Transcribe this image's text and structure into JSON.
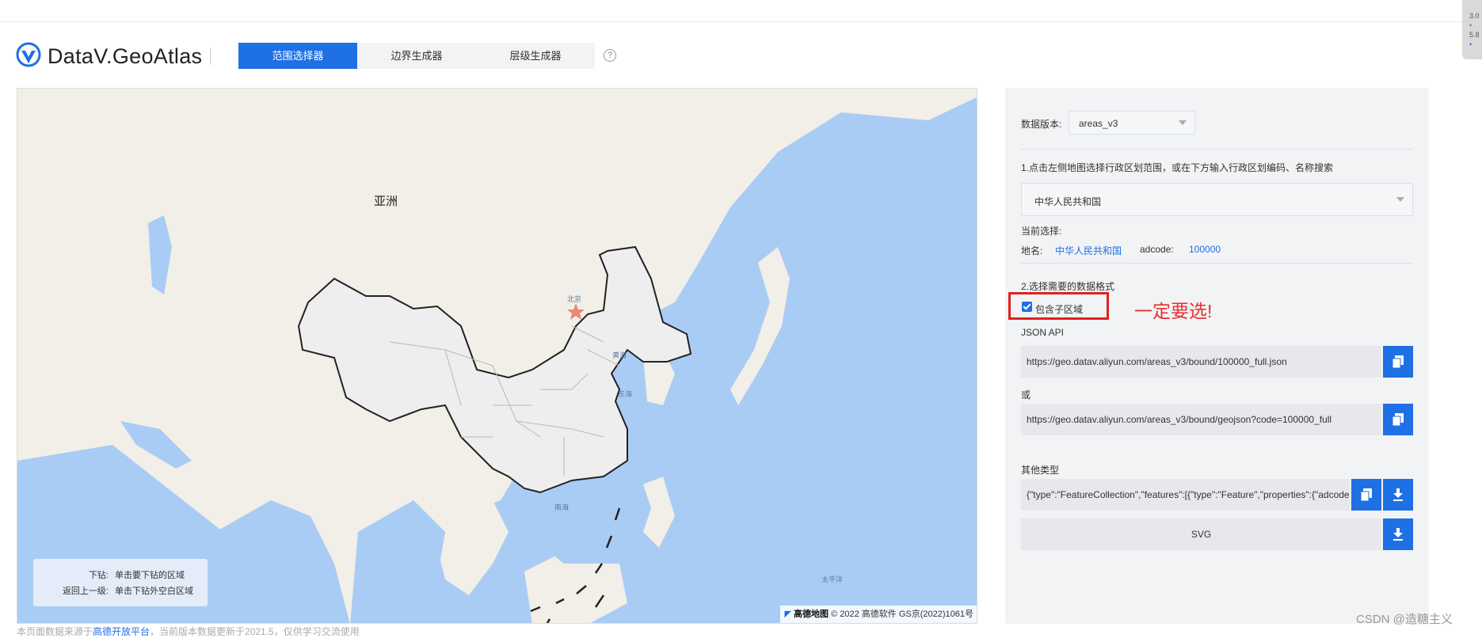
{
  "header": {
    "brand": "DataV.GeoAtlas",
    "tabs": [
      {
        "label": "范围选择器",
        "active": true
      },
      {
        "label": "边界生成器",
        "active": false
      },
      {
        "label": "层级生成器",
        "active": false
      }
    ],
    "help_glyph": "?"
  },
  "right_edge": {
    "line1": "3.0",
    "line2": "5.8"
  },
  "map": {
    "continent_label": "亚洲",
    "city_label": "北京",
    "sea_labels": [
      "黄海",
      "东海",
      "南海",
      "太平洋"
    ],
    "hint": [
      {
        "key": "下钻:",
        "value": "单击要下钻的区域"
      },
      {
        "key": "返回上一级:",
        "value": "单击下钻外空白区域"
      }
    ],
    "attribution": {
      "brand": "高德地图",
      "text": "© 2022 高德软件 GS京(2022)1061号"
    },
    "colors": {
      "ocean": "#a9ccf4",
      "land": "#f1efe8",
      "selected": "#eeeeee",
      "border": "#222222"
    }
  },
  "footnote": {
    "before": "本页面数据来源于",
    "link": "高德开放平台",
    "after": "，当前版本数据更新于2021.5，仅供学习交流使用"
  },
  "panel": {
    "version_label": "数据版本:",
    "version_value": "areas_v3",
    "step1": "1.点击左侧地图选择行政区划范围，或在下方输入行政区划编码、名称搜索",
    "region_select": "中华人民共和国",
    "current_label": "当前选择:",
    "name_label": "地名:",
    "name_value": "中华人民共和国",
    "adcode_label": "adcode:",
    "adcode_value": "100000",
    "step2": "2.选择需要的数据格式",
    "include_children_label": "包含子区域",
    "include_children_checked": true,
    "json_api_label": "JSON API",
    "url1": "https://geo.datav.aliyun.com/areas_v3/bound/100000_full.json",
    "or_label": "或",
    "url2": "https://geo.datav.aliyun.com/areas_v3/bound/geojson?code=100000_full",
    "other_label": "其他类型",
    "geojson_preview": "{\"type\":\"FeatureCollection\",\"features\":[{\"type\":\"Feature\",\"properties\":{\"adcode\"",
    "svg_label": "SVG",
    "accent": "#1f6fe5"
  },
  "annotation": {
    "text": "一定要选!",
    "color": "#e53030"
  },
  "watermark": "CSDN @造糖主义"
}
